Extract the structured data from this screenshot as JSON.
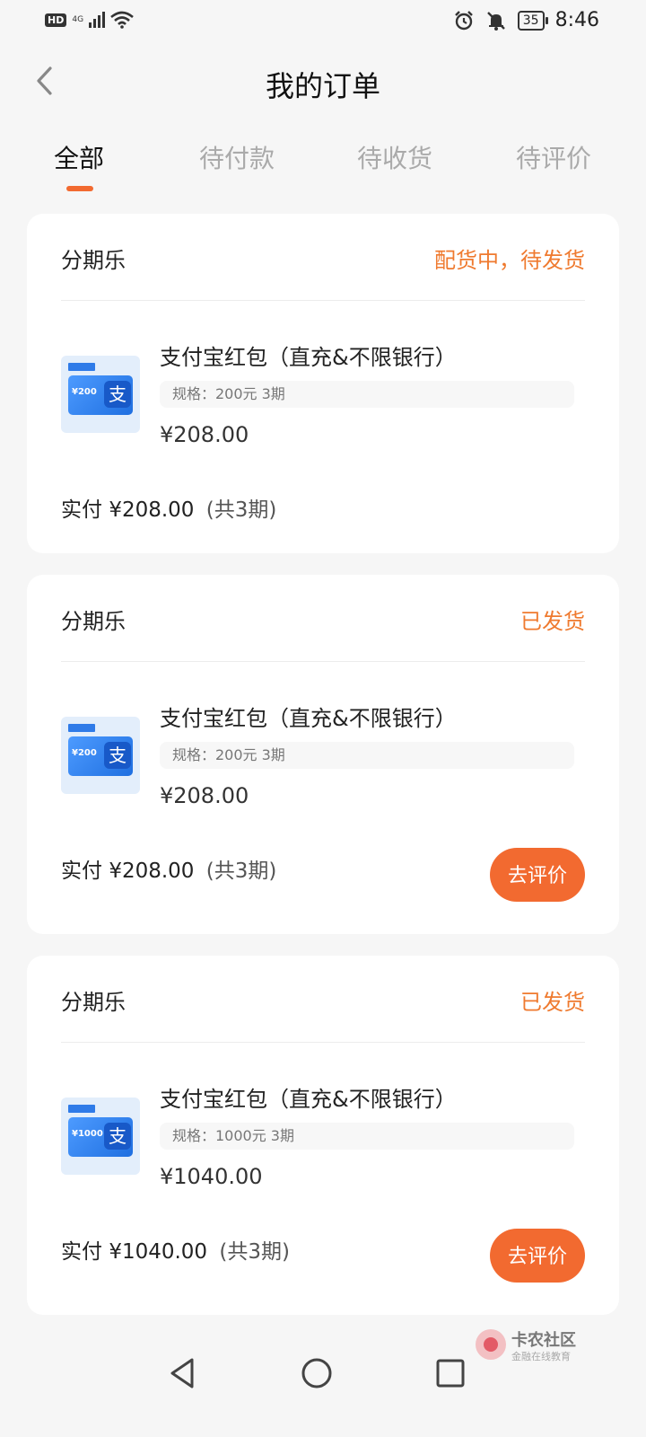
{
  "statusbar": {
    "hd": "HD",
    "network": "4G",
    "battery": "35",
    "time": "8:46",
    "icons": [
      "signal-icon",
      "wifi-icon",
      "alarm-icon",
      "mute-bell-icon",
      "battery-icon"
    ]
  },
  "header": {
    "title": "我的订单",
    "back_icon": "chevron-left-icon"
  },
  "tabs": [
    {
      "label": "全部",
      "active": true
    },
    {
      "label": "待付款",
      "active": false
    },
    {
      "label": "待收货",
      "active": false
    },
    {
      "label": "待评价",
      "active": false
    }
  ],
  "orders": [
    {
      "shop": "分期乐",
      "status": "配货中，待发货",
      "product_name": "支付宝红包（直充&不限银行）",
      "spec": "规格：200元 3期",
      "price": "¥208.00",
      "paid_label": "实付",
      "paid_amount": "¥208.00",
      "periods": "(共3期)",
      "thumb_amount": "¥200"
    },
    {
      "shop": "分期乐",
      "status": "已发货",
      "product_name": "支付宝红包（直充&不限银行）",
      "spec": "规格：200元 3期",
      "price": "¥208.00",
      "paid_label": "实付",
      "paid_amount": "¥208.00",
      "periods": "(共3期)",
      "thumb_amount": "¥200",
      "action": "去评价"
    },
    {
      "shop": "分期乐",
      "status": "已发货",
      "product_name": "支付宝红包（直充&不限银行）",
      "spec": "规格：1000元 3期",
      "price": "¥1040.00",
      "paid_label": "实付",
      "paid_amount": "¥1040.00",
      "periods": "(共3期)",
      "thumb_amount": "¥1000",
      "action": "去评价"
    }
  ],
  "watermark": {
    "title": "卡农社区",
    "subtitle": "金融在线教育"
  },
  "navbar": {
    "icons": [
      "back-triangle-icon",
      "home-circle-icon",
      "recents-square-icon"
    ]
  },
  "colors": {
    "accent": "#f26a30",
    "status": "#ef7a2f",
    "background": "#f6f6f6"
  }
}
